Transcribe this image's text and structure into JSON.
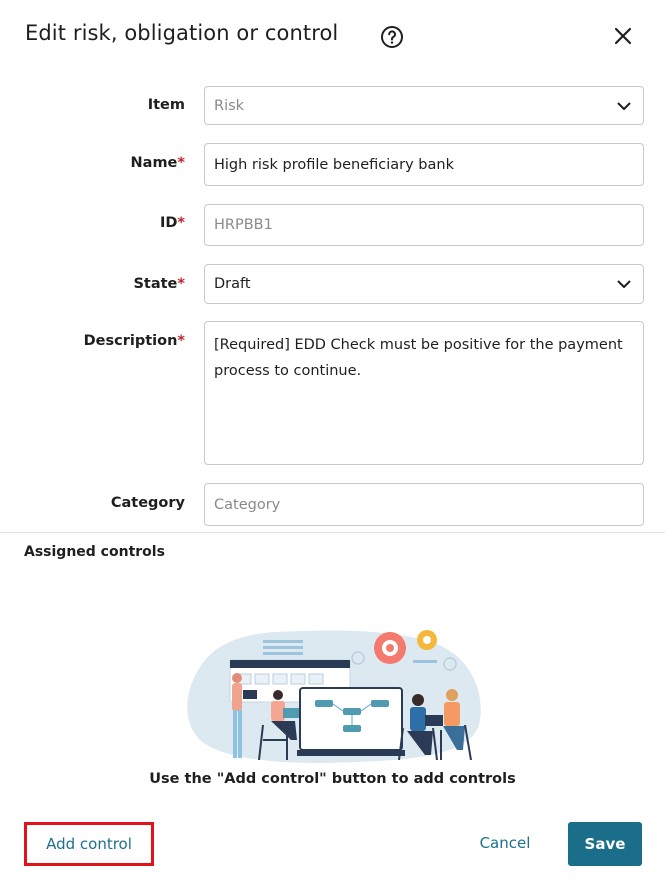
{
  "dialog": {
    "title": "Edit risk, obligation or control"
  },
  "form": {
    "item": {
      "label": "Item",
      "value": "Risk"
    },
    "name": {
      "label": "Name",
      "required_mark": "*",
      "value": "High risk profile beneficiary bank"
    },
    "id": {
      "label": "ID",
      "required_mark": "*",
      "value": "HRPBB1"
    },
    "state": {
      "label": "State",
      "required_mark": "*",
      "value": "Draft"
    },
    "description": {
      "label": "Description",
      "required_mark": "*",
      "value": "[Required] EDD Check must be positive for the payment process to continue."
    },
    "category": {
      "label": "Category",
      "placeholder": "Category"
    }
  },
  "assigned_controls": {
    "title": "Assigned controls",
    "empty_message": "Use the \"Add control\" button to add controls"
  },
  "footer": {
    "add_control_label": "Add control",
    "cancel_label": "Cancel",
    "save_label": "Save"
  },
  "colors": {
    "accent": "#1a6e8a",
    "link": "#1d6f8c",
    "required": "#c0262d",
    "highlight": "#e0131b"
  },
  "icons": {
    "help": "question-circle-icon",
    "close": "close-icon",
    "dropdown": "chevron-down-icon"
  }
}
